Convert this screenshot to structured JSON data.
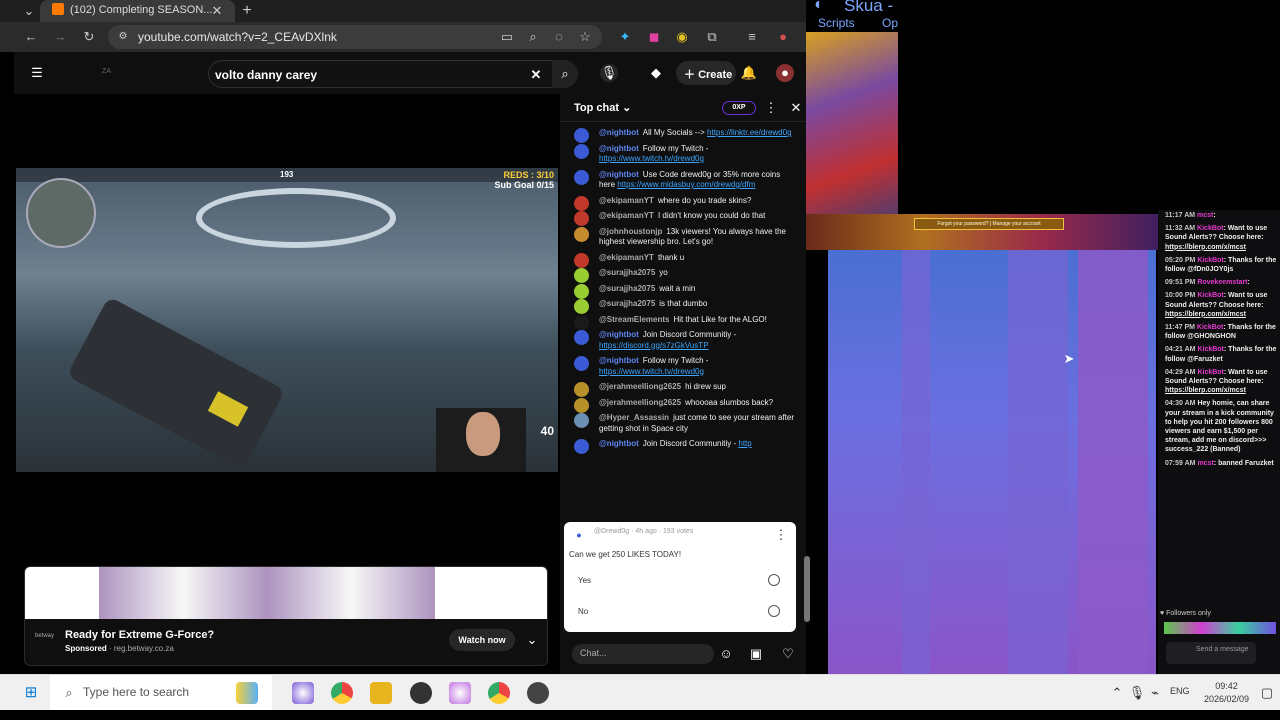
{
  "browser": {
    "tab_title": "(102) Completing SEASON...",
    "url": "youtube.com/watch?v=2_CEAvDXlnk"
  },
  "youtube": {
    "search_value": "volto danny carey",
    "create_label": "Create",
    "header_small_text": "ZA"
  },
  "video": {
    "hud_reds": "REDS : 3/10",
    "hud_goal": "Sub Goal 0/15",
    "hud_compass": "193",
    "ammo": "40"
  },
  "ad": {
    "title": "Ready for Extreme G-Force?",
    "sponsored": "Sponsored",
    "domain": "reg.betway.co.za",
    "brand": "betway",
    "cta": "Watch now"
  },
  "chat": {
    "title": "Top chat",
    "xp_badge": "0XP",
    "messages": [
      {
        "author": "@nightbot",
        "text": "All My Socials --> ",
        "link": "https://linktr.ee/drewd0g",
        "color": "#3b5bd6"
      },
      {
        "author": "@nightbot",
        "text": "Follow my Twitch - ",
        "link": "https://www.twitch.tv/drewd0g",
        "color": "#3b5bd6"
      },
      {
        "author": "@nightbot",
        "text": "Use Code drewd0g or 35% more coins here ",
        "link": "https://www.midasbuy.com/drewdg/dfm",
        "color": "#3b5bd6"
      },
      {
        "author": "@ekipamanYT",
        "text": "where do you trade skins?",
        "link": "",
        "color": "#c0392b"
      },
      {
        "author": "@ekipamanYT",
        "text": "I didn't know you could do that",
        "link": "",
        "color": "#c0392b"
      },
      {
        "author": "@johnhoustonjp",
        "text": "13k viewers! You always have the highest viewership bro. Let's go!",
        "link": "",
        "color": "#c58b2e"
      },
      {
        "author": "@ekipamanYT",
        "text": "thank u",
        "link": "",
        "color": "#c0392b"
      },
      {
        "author": "@surajjha2075",
        "text": "yo",
        "link": "",
        "color": "#9acd32"
      },
      {
        "author": "@surajjha2075",
        "text": "wait a min",
        "link": "",
        "color": "#9acd32"
      },
      {
        "author": "@surajjha2075",
        "text": "is that dumbo",
        "link": "",
        "color": "#9acd32"
      },
      {
        "author": "@StreamElements",
        "text": "Hit that Like for the ALGO!",
        "link": "",
        "color": "#1a1a1a"
      },
      {
        "author": "@nightbot",
        "text": "Join Discord Communitiy - ",
        "link": "https://discord.gg/s7zGkVusTP",
        "color": "#3b5bd6"
      },
      {
        "author": "@nightbot",
        "text": "Follow my Twitch - ",
        "link": "https://www.twitch.tv/drewd0g",
        "color": "#3b5bd6"
      },
      {
        "author": "@jerahmeelliong2625",
        "text": "hi drew sup",
        "link": "",
        "color": "#b8902a"
      },
      {
        "author": "@jerahmeelliong2625",
        "text": "whoooaa slumbos back?",
        "link": "",
        "color": "#b8902a"
      },
      {
        "author": "@Hyper_Assassin",
        "text": "just come to see your stream after getting shot in Space city",
        "link": "",
        "color": "#6a8fb0"
      },
      {
        "author": "@nightbot",
        "text": "Join Discord Communitiy - ",
        "link": "http",
        "color": "#3b5bd6"
      }
    ],
    "poll": {
      "meta": "@Drewd0g · 4h ago · 193 votes",
      "question": "Can we get 250 LIKES TODAY!",
      "options": [
        "Yes",
        "No"
      ]
    },
    "input_placeholder": "Chat..."
  },
  "right_app": {
    "title": "Skua -",
    "menu": [
      "Scripts",
      "Op"
    ],
    "game_buttons": "Forgot your password? | Manage your account"
  },
  "side_chat": {
    "messages": [
      {
        "time": "11:17 AM",
        "name": "mcst",
        "text": ""
      },
      {
        "time": "11:32 AM",
        "name": "KickBot",
        "text": "Want to use Sound Alerts?? Choose here: ",
        "link": "https://blerp.com/x/mcst"
      },
      {
        "time": "05:20 PM",
        "name": "KickBot",
        "text": "Thanks for the follow @fDn0JOY0js",
        "link": ""
      },
      {
        "time": "09:51 PM",
        "name": "Rovekeemstart",
        "text": "",
        "link": ""
      },
      {
        "time": "10:00 PM",
        "name": "KickBot",
        "text": "Want to use Sound Alerts?? Choose here: ",
        "link": "https://blerp.com/x/mcst"
      },
      {
        "time": "11:47 PM",
        "name": "KickBot",
        "text": "Thanks for the follow @GHONGHON",
        "link": ""
      },
      {
        "time": "04:21 AM",
        "name": "KickBot",
        "text": "Thanks for the follow @Faruzket",
        "link": ""
      },
      {
        "time": "04:29 AM",
        "name": "KickBot",
        "text": "Want to use Sound Alerts?? Choose here: ",
        "link": "https://blerp.com/x/mcst"
      },
      {
        "time": "04:30 AM",
        "name": "",
        "text": "Hey homie, can share your stream in a kick community to help you hit 200 followers 800 viewers and earn $1,500 per stream, add me on discord>>> success_222 (Banned)",
        "link": ""
      },
      {
        "time": "07:59 AM",
        "name": "mcst",
        "text": "banned Faruzket",
        "link": ""
      }
    ],
    "followers_only": "Followers only",
    "send_label": "Send a message"
  },
  "taskbar": {
    "search_placeholder": "Type here to search",
    "lang": "ENG",
    "time": "09:42",
    "date": "2026/02/09"
  }
}
